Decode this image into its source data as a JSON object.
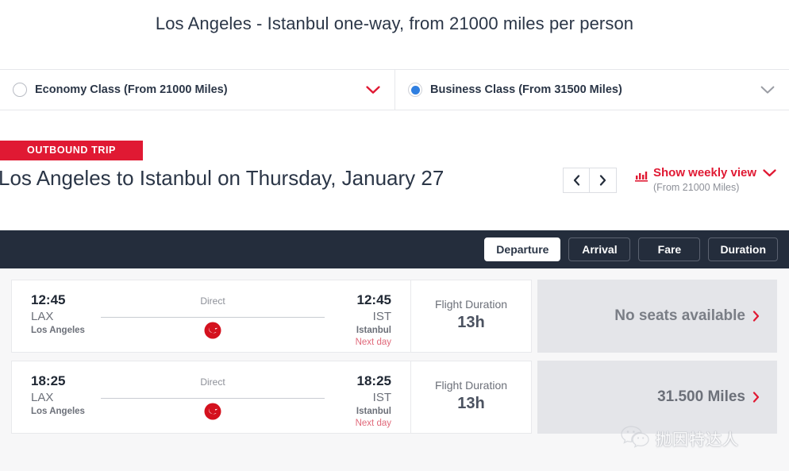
{
  "header": {
    "title": "Los Angeles - Istanbul one-way, from 21000 miles per person"
  },
  "cabin_classes": [
    {
      "label": "Economy Class (From 21000 Miles)",
      "selected": false,
      "caret_icon": "chevron-down-icon",
      "caret_color": "#e01933"
    },
    {
      "label": "Business Class (From 31500 Miles)",
      "selected": true,
      "caret_icon": "chevron-down-icon",
      "caret_color": "#8d9098"
    }
  ],
  "outbound": {
    "badge": "OUTBOUND TRIP",
    "route_title": "Los Angeles to Istanbul on Thursday, January 27",
    "prev_label": "‹",
    "next_label": "›",
    "weekly_main": "Show weekly view",
    "weekly_sub": "(From 21000 Miles)",
    "weekly_icon": "bar-chart-icon"
  },
  "sort_tabs": [
    {
      "label": "Departure",
      "active": true
    },
    {
      "label": "Arrival",
      "active": false
    },
    {
      "label": "Fare",
      "active": false
    },
    {
      "label": "Duration",
      "active": false
    }
  ],
  "flights": [
    {
      "depart_time": "12:45",
      "depart_code": "LAX",
      "depart_city": "Los Angeles",
      "stops": "Direct",
      "airline_icon": "turkish-airlines-logo",
      "arrive_time": "12:45",
      "arrive_code": "IST",
      "arrive_city": "Istanbul",
      "arrive_note": "Next day",
      "duration_label": "Flight Duration",
      "duration_value": "13h",
      "fare": "No seats available",
      "fare_available": false,
      "fare_chevron": "chevron-right-icon"
    },
    {
      "depart_time": "18:25",
      "depart_code": "LAX",
      "depart_city": "Los Angeles",
      "stops": "Direct",
      "airline_icon": "turkish-airlines-logo",
      "arrive_time": "18:25",
      "arrive_code": "IST",
      "arrive_city": "Istanbul",
      "arrive_note": "Next day",
      "duration_label": "Flight Duration",
      "duration_value": "13h",
      "fare": "31.500 Miles",
      "fare_available": true,
      "fare_chevron": "chevron-right-icon"
    }
  ],
  "watermark": {
    "icon": "wechat-logo",
    "text": "抛因特达人"
  },
  "colors": {
    "brand_red": "#e01933",
    "dark_navy": "#242d3c",
    "radio_blue": "#2f7fe0",
    "panel_gray": "#e4e5e9"
  }
}
